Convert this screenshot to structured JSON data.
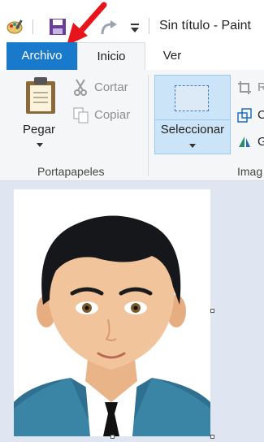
{
  "window": {
    "title": "Sin título - Paint"
  },
  "tabs": [
    {
      "label": "Archivo"
    },
    {
      "label": "Inicio"
    },
    {
      "label": "Ver"
    }
  ],
  "ribbon": {
    "clipboard": {
      "group_label": "Portapapeles",
      "paste_label": "Pegar",
      "cut_label": "Cortar",
      "copy_label": "Copiar"
    },
    "image": {
      "group_label": "Imag",
      "select_label": "Seleccionar",
      "crop_label": "R",
      "resize_label": "C",
      "rotate_label": "G"
    }
  },
  "icons": [
    "paint-app-icon",
    "save-icon",
    "redo-icon",
    "qat-dropdown-icon",
    "paste-icon",
    "cut-icon",
    "copy-icon",
    "select-icon",
    "crop-icon",
    "resize-icon",
    "rotate-icon",
    "red-arrow-annotation"
  ],
  "colors": {
    "file_tab": "#1979ca",
    "select_highlight": "#cce4f7",
    "canvas_bg": "#dfe6f2",
    "annotation_arrow": "#e8141c"
  }
}
